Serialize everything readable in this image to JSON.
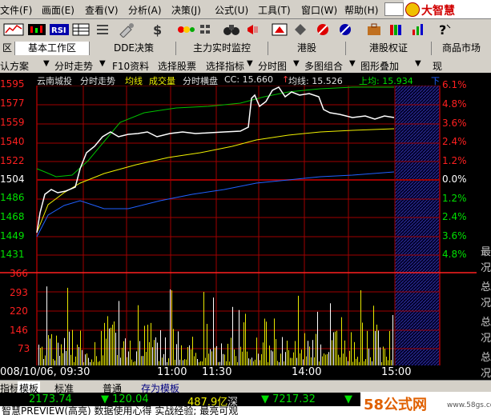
{
  "menu": {
    "items": [
      "文件(F)",
      "画面(E)",
      "查看(V)",
      "分析(A)",
      "决策(J)",
      "公式(U)",
      "工具(T)",
      "窗口(W)",
      "帮助(H)"
    ],
    "logo_text": "大智慧"
  },
  "tabs": {
    "items": [
      "区",
      "基本工作区",
      "DDE决策",
      "主力实时监控",
      "港股",
      "港股权证",
      "商品市场"
    ]
  },
  "funcbar": {
    "items": [
      "认方案",
      "分时走势",
      "F10资料",
      "选择股票",
      "选择指标",
      "分时图",
      "多图组合",
      "图形叠加",
      "现"
    ]
  },
  "info": {
    "stock_name": "云南城投",
    "view": "分时走势",
    "avg_line": "均线",
    "volume": "成交量",
    "panel": "分时横盘",
    "cc_label": "CC: 15.660",
    "arrow": "↑",
    "avg_label": "均线: 15.526",
    "upper_avg": "上均: 15.934",
    "tail": "下"
  },
  "price_labels": [
    "1595",
    "1577",
    "1559",
    "1540",
    "1522",
    "1504",
    "1486",
    "1468",
    "1449",
    "1431"
  ],
  "pct_labels": [
    "6.1%",
    "4.8%",
    "3.6%",
    "2.4%",
    "1.2%",
    "0.0%",
    "1.2%",
    "2.4%",
    "3.6%",
    "4.8%"
  ],
  "vol_labels": [
    "366",
    "293",
    "220",
    "146",
    "73"
  ],
  "time_labels": {
    "start": "008/10/06, 09:30",
    "t1": "11:00",
    "t2": "11:30",
    "t3": "14:00",
    "t4": "15:00"
  },
  "bottom_tabs": [
    "指标",
    "模板",
    "标准",
    "普通",
    "存为模板"
  ],
  "index_bar": {
    "v1": "2173.74",
    "v2": "▼ 120.04",
    "v3": "487.9亿",
    "v4": "深",
    "v5": "▼ 7217.32",
    "v6": "▼"
  },
  "news": "智慧PREVIEW(高亮) 数据使用心得 实战经验; 最亮可观",
  "watermark": {
    "text": "58公式网",
    "url": "www.58gs.com"
  },
  "right_vertical": [
    "最",
    "况",
    "总",
    "况",
    "总",
    "况",
    "总",
    "况"
  ],
  "chart_data": {
    "type": "line",
    "series": [
      {
        "name": "price",
        "color": "#ffffff"
      },
      {
        "name": "均线",
        "color": "#f0f000"
      },
      {
        "name": "上均",
        "color": "#00c000"
      },
      {
        "name": "下均",
        "color": "#2050ff"
      }
    ],
    "ylim": [
      1431,
      1595
    ],
    "reference_price": 1504,
    "colors": {
      "up": "#ff2020",
      "down": "#00d000",
      "grid": "#a00000"
    }
  }
}
